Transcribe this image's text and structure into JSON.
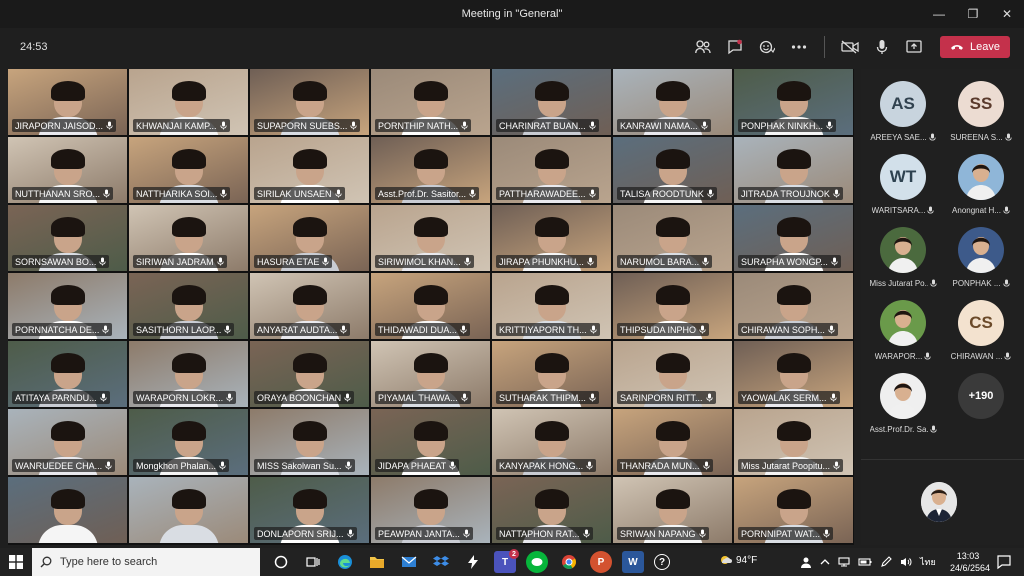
{
  "window": {
    "title": "Meeting in \"General\"",
    "controls": [
      "—",
      "❐",
      "✕"
    ]
  },
  "toolbar": {
    "timer": "24:53",
    "leave_label": "Leave",
    "icons": [
      "participants-icon",
      "chat-icon",
      "reactions-icon",
      "more-icon",
      "camera-off-icon",
      "mic-icon",
      "share-icon"
    ]
  },
  "grid": {
    "rows": [
      [
        "JIRAPORN JAISOD...",
        "KHWANJAI KAMP...",
        "SUPAPORN SUEBS...",
        "PORNTHIP NATH...",
        "CHARINRAT BUAN...",
        "KANRAWI NAMA...",
        "PONPHAK NINKH..."
      ],
      [
        "NUTTHANAN SRO...",
        "NATTHARIKA SOI...",
        "SIRILAK UNSAEN",
        "Asst.Prof.Dr. Sasitor...",
        "PATTHARAWADEE...",
        "TALISA ROODTUNK",
        "JITRADA TROUJNOK"
      ],
      [
        "SORNSAWAN BO...",
        "SIRIWAN JADRAM",
        "HASURA ETAE",
        "SIRIWIMOL KHAN...",
        "JIRAPA PHUNKHU...",
        "NARUMOL BARA...",
        "SURAPHA WONGP..."
      ],
      [
        "PORNNATCHA DE...",
        "SASITHORN LAOP...",
        "ANYARAT AUDTA...",
        "THIDAWADI DUA...",
        "KRITTIYAPORN TH...",
        "THIPSUDA INPHO",
        "CHIRAWAN SOPH..."
      ],
      [
        "ATITAYA PARNDU...",
        "WARAPORN LOKR...",
        "ORAYA BOONCHAN",
        "PIYAMAL THAWA...",
        "SUTHARAK THIPM...",
        "SARINPORN RITT...",
        "YAOWALAK SERM..."
      ],
      [
        "WANRUEDEE CHA...",
        "Mongkhon Phalan...",
        "MISS Sakolwan Su...",
        "JIDAPA PHAEAT",
        "KANYAPAK HONG...",
        "THANRADA MUN...",
        "Miss Jutarat Poopitu..."
      ],
      [
        "",
        "",
        "DONLAPORN SRIJ...",
        "PEAWPAN JANTA...",
        "NATTAPHON RAT...",
        "SRIWAN NAPANG",
        "PORNNIPAT WAT..."
      ]
    ]
  },
  "roster": {
    "items": [
      {
        "initials": "AS",
        "name": "AREEYA SAE...",
        "bg": "#c8d4de",
        "fg": "#31424f"
      },
      {
        "initials": "SS",
        "name": "SUREENA S...",
        "bg": "#ecdcd2",
        "fg": "#5a3a2c"
      },
      {
        "initials": "WT",
        "name": "WARITSARA...",
        "bg": "#d2e0ea",
        "fg": "#2e4250"
      },
      {
        "initials": "",
        "name": "Anongnat H...",
        "bg": "#8fb6d8",
        "fg": "#ffffff"
      },
      {
        "initials": "",
        "name": "Miss Jutarat Po...",
        "bg": "#4b6a3e",
        "fg": "#ffffff"
      },
      {
        "initials": "",
        "name": "PONPHAK ...",
        "bg": "#3d5a8a",
        "fg": "#ffffff"
      },
      {
        "initials": "",
        "name": "WARAPOR...",
        "bg": "#6a9a4a",
        "fg": "#ffffff"
      },
      {
        "initials": "CS",
        "name": "CHIRAWAN ...",
        "bg": "#f3e2cf",
        "fg": "#6b4a2a"
      },
      {
        "initials": "",
        "name": "Asst.Prof.Dr. Sa...",
        "bg": "#efefef",
        "fg": "#333333"
      },
      {
        "initials": "+190",
        "name": "",
        "bg": "#3a3a3a",
        "fg": "#ffffff"
      }
    ]
  },
  "taskbar": {
    "search_placeholder": "Type here to search",
    "teams_badge": "2",
    "weather": "94°F",
    "language": "ไทย",
    "time": "13:03",
    "date": "24/6/2564"
  }
}
